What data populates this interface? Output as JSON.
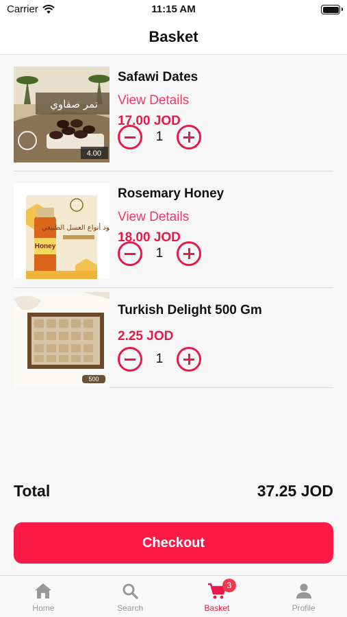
{
  "status_bar": {
    "carrier": "Carrier",
    "time": "11:15 AM"
  },
  "header": {
    "title": "Basket"
  },
  "items": [
    {
      "name": "Safawi Dates",
      "details_link": "View Details",
      "price": "17.00 JOD",
      "quantity": "1",
      "image_arabic": "تمر صفاوي",
      "image_tag": "4.00"
    },
    {
      "name": "Rosemary Honey",
      "details_link": "View Details",
      "price": "18.00 JOD",
      "quantity": "1",
      "image_arabic": "أجود أنواع العسل الطبيعي",
      "image_jar_text": "Honey"
    },
    {
      "name": "Turkish Delight 500 Gm",
      "price": "2.25 JOD",
      "quantity": "1",
      "image_tag": "500"
    }
  ],
  "summary": {
    "total_label": "Total",
    "total_value": "37.25 JOD"
  },
  "checkout_label": "Checkout",
  "tabbar": {
    "home": "Home",
    "search": "Search",
    "basket": "Basket",
    "basket_badge": "3",
    "profile": "Profile"
  },
  "colors": {
    "accent": "#e8184a",
    "button": "#fa1a47"
  }
}
